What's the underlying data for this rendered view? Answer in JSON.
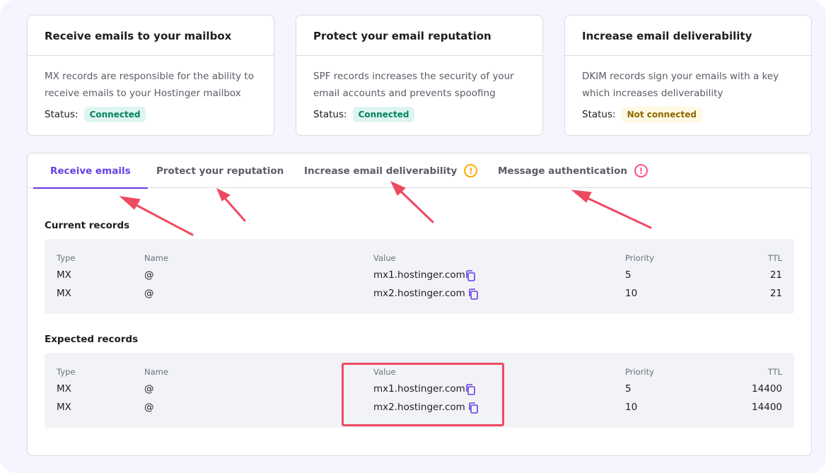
{
  "cards": [
    {
      "title": "Receive emails to your mailbox",
      "description": "MX records are responsible for the ability to receive emails to your Hostinger mailbox",
      "status_label": "Status:",
      "status_value": "Connected"
    },
    {
      "title": "Protect your email reputation",
      "description": "SPF records increases the security of your email accounts and prevents spoofing",
      "status_label": "Status:",
      "status_value": "Connected"
    },
    {
      "title": "Increase email deliverability",
      "description": "DKIM records sign your emails with a key which increases deliverability",
      "status_label": "Status:",
      "status_value": "Not connected"
    }
  ],
  "tabs": [
    {
      "label": "Receive emails",
      "active": true
    },
    {
      "label": "Protect your reputation",
      "active": false
    },
    {
      "label": "Increase email deliverability",
      "active": false,
      "icon": "!"
    },
    {
      "label": "Message authentication",
      "active": false,
      "icon": "!"
    }
  ],
  "current_records": {
    "title": "Current records",
    "headers": {
      "type": "Type",
      "name": "Name",
      "value": "Value",
      "priority": "Priority",
      "ttl": "TTL"
    },
    "rows": [
      {
        "type": "MX",
        "name": "@",
        "value": "mx1.hostinger.com",
        "priority": "5",
        "ttl": "21"
      },
      {
        "type": "MX",
        "name": "@",
        "value": "mx2.hostinger.com",
        "priority": "10",
        "ttl": "21"
      }
    ]
  },
  "expected_records": {
    "title": "Expected records",
    "headers": {
      "type": "Type",
      "name": "Name",
      "value": "Value",
      "priority": "Priority",
      "ttl": "TTL"
    },
    "rows": [
      {
        "type": "MX",
        "name": "@",
        "value": "mx1.hostinger.com",
        "priority": "5",
        "ttl": "14400"
      },
      {
        "type": "MX",
        "name": "@",
        "value": "mx2.hostinger.com",
        "priority": "10",
        "ttl": "14400"
      }
    ]
  },
  "colors": {
    "accent": "#673de6",
    "success_bg": "#def4f0",
    "success_text": "#008361",
    "warning_bg": "#fff8e2",
    "warning_text": "#8c6800",
    "annotation": "#ed4a62"
  },
  "icons": [
    "copy-icon",
    "warning-circle-icon",
    "error-circle-icon"
  ]
}
